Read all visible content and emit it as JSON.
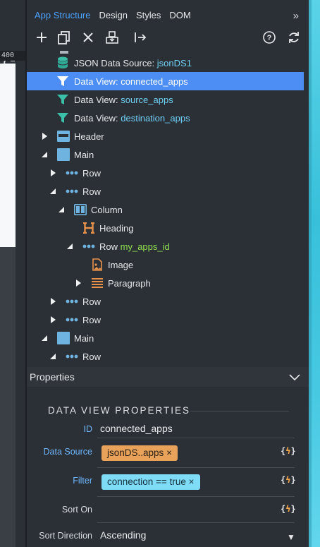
{
  "ruler_label": "400",
  "tabs": {
    "app_structure": "App Structure",
    "design": "Design",
    "styles": "Styles",
    "dom": "DOM",
    "more": "»"
  },
  "tree": {
    "json_ds": {
      "label": "JSON Data Source:",
      "name": "jsonDS1"
    },
    "dv_connected": {
      "label": "Data View:",
      "name": "connected_apps"
    },
    "dv_source": {
      "label": "Data View:",
      "name": "source_apps"
    },
    "dv_destination": {
      "label": "Data View:",
      "name": "destination_apps"
    },
    "header": "Header",
    "main1": "Main",
    "row1": "Row",
    "row2": "Row",
    "column": "Column",
    "heading": "Heading",
    "row_ids": {
      "label": "Row",
      "id": "my_apps_id"
    },
    "image": "Image",
    "paragraph": "Paragraph",
    "row3": "Row",
    "row4": "Row",
    "main2": "Main",
    "row5": "Row"
  },
  "properties": {
    "header": "Properties",
    "section_title": "DATA VIEW PROPERTIES",
    "id": {
      "label": "ID",
      "value": "connected_apps"
    },
    "data_source": {
      "label": "Data Source",
      "value": "jsonDS..apps",
      "remove": "×"
    },
    "filter": {
      "label": "Filter",
      "value": "connection == true",
      "remove": "×"
    },
    "sort_on": {
      "label": "Sort On",
      "value": ""
    },
    "sort_direction": {
      "label": "Sort Direction",
      "value": "Ascending",
      "caret": "▼"
    },
    "dynamic_glyph": {
      "open": "{",
      "bolt": "ϟ",
      "close": "}"
    }
  },
  "colors": {
    "accent_blue": "#4da3ff",
    "selected_row": "#4d8ef5",
    "data_view_icon": "#3bbfa8",
    "chip_orange": "#e8a25a",
    "chip_cyan": "#7fdcf7",
    "dynamic_orange": "#f3a64b"
  }
}
